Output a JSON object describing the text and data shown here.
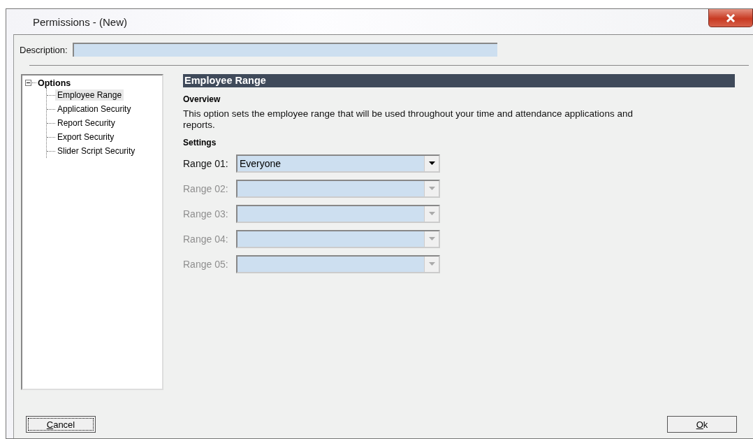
{
  "window": {
    "title": "Permissions - (New)"
  },
  "description": {
    "label": "Description:"
  },
  "tree": {
    "label": "Options",
    "expanded": true,
    "children": [
      {
        "label": "Employee Range",
        "selected": true
      },
      {
        "label": "Application Security",
        "selected": false
      },
      {
        "label": "Report Security",
        "selected": false
      },
      {
        "label": "Export Security",
        "selected": false
      },
      {
        "label": "Slider Script Security",
        "selected": false
      }
    ]
  },
  "panel": {
    "title": "Employee Range",
    "overview_heading": "Overview",
    "overview_text": "This option sets the employee range that will be used throughout your time and attendance applications and reports.",
    "settings_heading": "Settings",
    "ranges": [
      {
        "label": "Range 01:",
        "value": "Everyone",
        "disabled": false
      },
      {
        "label": "Range 02:",
        "disabled": true
      },
      {
        "label": "Range 03:",
        "disabled": true
      },
      {
        "label": "Range 04:",
        "disabled": true
      },
      {
        "label": "Range 05:",
        "disabled": true
      }
    ]
  },
  "buttons": [
    {
      "label": "Cancel",
      "focused": true
    },
    {
      "label": "Ok",
      "focused": false
    }
  ]
}
